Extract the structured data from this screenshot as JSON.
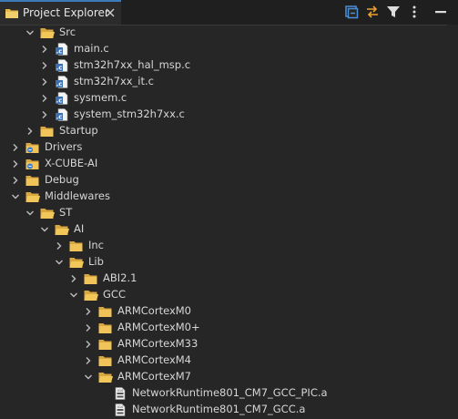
{
  "view": {
    "title": "Project Explorer",
    "toolbar": [
      "collapse-all",
      "link-with-editor",
      "filter",
      "view-menu",
      "minimize"
    ]
  },
  "tree": [
    {
      "label": "Src",
      "type": "folder",
      "depth": 2,
      "state": "expanded"
    },
    {
      "label": "main.c",
      "type": "c-file",
      "depth": 3,
      "state": "collapsed"
    },
    {
      "label": "stm32h7xx_hal_msp.c",
      "type": "c-file",
      "depth": 3,
      "state": "collapsed"
    },
    {
      "label": "stm32h7xx_it.c",
      "type": "c-file",
      "depth": 3,
      "state": "collapsed"
    },
    {
      "label": "sysmem.c",
      "type": "c-file",
      "depth": 3,
      "state": "collapsed"
    },
    {
      "label": "system_stm32h7xx.c",
      "type": "c-file",
      "depth": 3,
      "state": "collapsed"
    },
    {
      "label": "Startup",
      "type": "folder",
      "depth": 2,
      "state": "collapsed"
    },
    {
      "label": "Drivers",
      "type": "link-folder",
      "depth": 1,
      "state": "collapsed"
    },
    {
      "label": "X-CUBE-AI",
      "type": "link-folder",
      "depth": 1,
      "state": "collapsed"
    },
    {
      "label": "Debug",
      "type": "folder",
      "depth": 1,
      "state": "collapsed"
    },
    {
      "label": "Middlewares",
      "type": "folder",
      "depth": 1,
      "state": "expanded"
    },
    {
      "label": "ST",
      "type": "folder",
      "depth": 2,
      "state": "expanded"
    },
    {
      "label": "AI",
      "type": "folder",
      "depth": 3,
      "state": "expanded"
    },
    {
      "label": "Inc",
      "type": "folder",
      "depth": 4,
      "state": "collapsed"
    },
    {
      "label": "Lib",
      "type": "folder",
      "depth": 4,
      "state": "expanded"
    },
    {
      "label": "ABI2.1",
      "type": "folder",
      "depth": 5,
      "state": "collapsed"
    },
    {
      "label": "GCC",
      "type": "folder",
      "depth": 5,
      "state": "expanded"
    },
    {
      "label": "ARMCortexM0",
      "type": "folder",
      "depth": 6,
      "state": "collapsed"
    },
    {
      "label": "ARMCortexM0+",
      "type": "folder",
      "depth": 6,
      "state": "collapsed"
    },
    {
      "label": "ARMCortexM33",
      "type": "folder",
      "depth": 6,
      "state": "collapsed"
    },
    {
      "label": "ARMCortexM4",
      "type": "folder",
      "depth": 6,
      "state": "collapsed"
    },
    {
      "label": "ARMCortexM7",
      "type": "folder",
      "depth": 6,
      "state": "expanded"
    },
    {
      "label": "NetworkRuntime801_CM7_GCC_PIC.a",
      "type": "archive",
      "depth": 7,
      "state": "leaf"
    },
    {
      "label": "NetworkRuntime801_CM7_GCC.a",
      "type": "archive",
      "depth": 7,
      "state": "leaf"
    }
  ],
  "colors": {
    "background": "#262626",
    "folder": "#e8b94a",
    "c_file_badge": "#3b6fb0",
    "text": "#d6d6d6",
    "tab_accent": "#3c7ab8"
  }
}
